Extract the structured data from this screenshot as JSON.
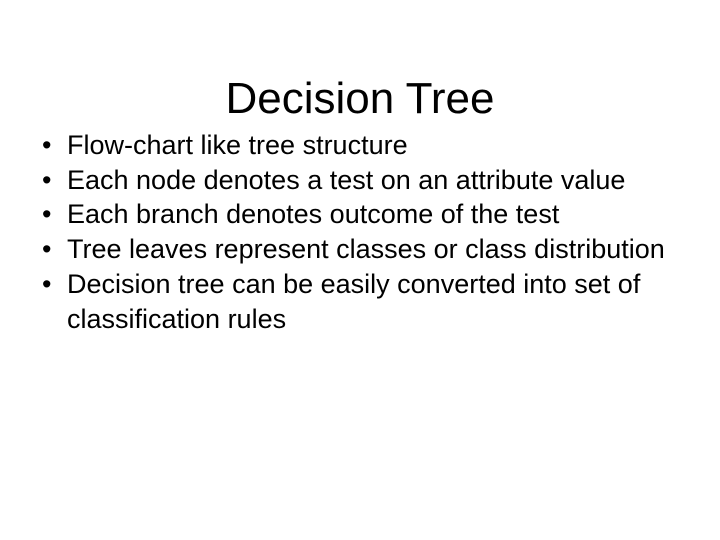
{
  "slide": {
    "title": "Decision Tree",
    "background_color": "#ffffff",
    "text_color": "#000000",
    "bullet_glyph": "•",
    "bullets": [
      {
        "text": "Flow-chart like tree structure"
      },
      {
        "text": "Each node denotes a test on an attribute value"
      },
      {
        "text": "Each branch denotes outcome of the test"
      },
      {
        "text": "Tree leaves represent classes or class distribution"
      },
      {
        "text": "Decision tree can be easily converted into set of classification rules"
      }
    ]
  }
}
